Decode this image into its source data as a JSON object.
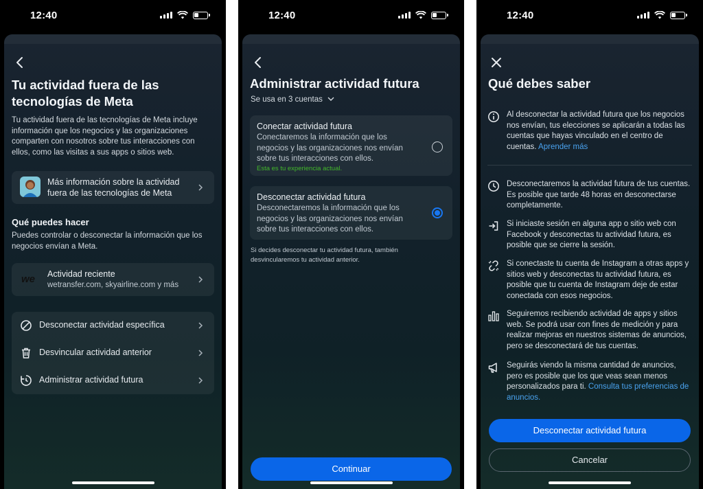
{
  "status": {
    "time": "12:40"
  },
  "screen1": {
    "title_line1": "Tu actividad fuera de las",
    "title_line2": "tecnologías de Meta",
    "intro": "Tu actividad fuera de las tecnologías de Meta incluye información que los negocios y las organizaciones comparten con nosotros sobre tus interacciones con ellos, como las visitas a sus apps o sitios web.",
    "more_info_line1": "Más información sobre la actividad",
    "more_info_line2": "fuera de las tecnologías de Meta",
    "section_heading": "Qué puedes hacer",
    "section_text": "Puedes controlar o desconectar la información que los negocios envían a Meta.",
    "recent_title": "Actividad reciente",
    "recent_sub": "wetransfer.com, skyairline.com y más",
    "recent_logo": "we",
    "actions": [
      {
        "label": "Desconectar actividad específica",
        "icon": "block-icon"
      },
      {
        "label": "Desvincular actividad anterior",
        "icon": "trash-icon"
      },
      {
        "label": "Administrar actividad futura",
        "icon": "clock-arrow-icon"
      }
    ]
  },
  "screen2": {
    "title": "Administrar actividad futura",
    "accounts": "Se usa en 3 cuentas",
    "option1": {
      "title": "Conectar actividad futura",
      "desc": "Conectaremos la información que los negocios y las organizaciones nos envían sobre tus interacciones con ellos.",
      "current": "Esta es tu experiencia actual.",
      "selected": false
    },
    "option2": {
      "title": "Desconectar actividad futura",
      "desc": "Desconectaremos la información que los negocios y las organizaciones nos envían sobre tus interacciones con ellos.",
      "selected": true
    },
    "note": "Si decides desconectar tu actividad futura, también desvincularemos tu actividad anterior.",
    "continue": "Continuar"
  },
  "screen3": {
    "title": "Qué debes saber",
    "info1_text": "Al desconectar la actividad futura que los negocios nos envían, tus elecciones se aplicarán a todas las cuentas que hayas vinculado en el centro de cuentas.",
    "info1_link": "Aprender más",
    "items": [
      {
        "icon": "clock-icon",
        "text": "Desconectaremos la actividad futura de tus cuentas. Es posible que tarde 48 horas en desconectarse completamente."
      },
      {
        "icon": "login-icon",
        "text": "Si iniciaste sesión en alguna app o sitio web con Facebook y desconectas tu actividad futura, es posible que se cierre la sesión."
      },
      {
        "icon": "unlink-icon",
        "text": "Si conectaste tu cuenta de Instagram a otras apps y sitios web y desconectas tu actividad futura, es posible que tu cuenta de Instagram deje de estar conectada con esos negocios."
      },
      {
        "icon": "bar-chart-icon",
        "text": "Seguiremos recibiendo actividad de apps y sitios web. Se podrá usar con fines de medición y para realizar mejoras en nuestros sistemas de anuncios, pero se desconectará de tus cuentas."
      }
    ],
    "ads_text": "Seguirás viendo la misma cantidad de anuncios, pero es posible que los que veas sean menos personalizados para ti.",
    "ads_link": "Consulta tus preferencias de anuncios.",
    "primary_btn": "Desconectar actividad futura",
    "cancel_btn": "Cancelar"
  },
  "colors": {
    "accent": "#0a66e8",
    "link": "#4aa3f0",
    "success": "#42b72a"
  }
}
